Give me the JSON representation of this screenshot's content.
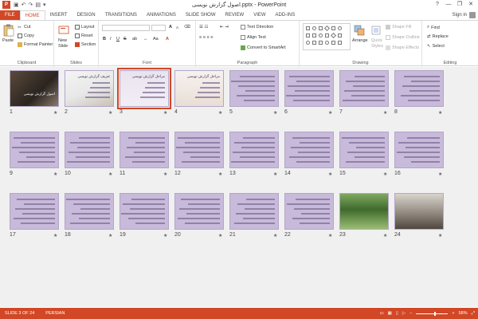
{
  "window": {
    "title": "اصول گزارش نویسی.pptx - PowerPoint",
    "controls": [
      "?",
      "—",
      "❐",
      "✕"
    ]
  },
  "tabs": [
    "FILE",
    "HOME",
    "INSERT",
    "DESIGN",
    "TRANSITIONS",
    "ANIMATIONS",
    "SLIDE SHOW",
    "REVIEW",
    "VIEW",
    "ADD-INS"
  ],
  "active_tab": "HOME",
  "signin": "Sign in",
  "ribbon": {
    "clipboard": {
      "label": "Clipboard",
      "paste": "Paste",
      "cut": "Cut",
      "copy": "Copy",
      "format_painter": "Format Painter"
    },
    "slides": {
      "label": "Slides",
      "new_slide_1": "New",
      "new_slide_2": "Slide",
      "layout": "Layout",
      "reset": "Reset",
      "section": "Section"
    },
    "font": {
      "label": "Font",
      "bold": "B",
      "italic": "I",
      "underline": "U",
      "strike": "S",
      "aa_grow": "A",
      "aa_shrink": "A"
    },
    "paragraph": {
      "label": "Paragraph",
      "text_direction": "Text Direction",
      "align_text": "Align Text",
      "convert_smartart": "Convert to SmartArt"
    },
    "drawing": {
      "label": "Drawing",
      "arrange": "Arrange",
      "quick_styles_1": "Quick",
      "quick_styles_2": "Styles",
      "shape_fill": "Shape Fill",
      "shape_outline": "Shape Outline",
      "shape_effects": "Shape Effects"
    },
    "editing": {
      "label": "Editing",
      "find": "Find",
      "replace": "Replace",
      "select": "Select"
    }
  },
  "slides": [
    {
      "n": "1",
      "kind": "img1",
      "title": "اصول گزارش نویسی"
    },
    {
      "n": "2",
      "kind": "img2",
      "title": "تعریف گزارش نویسی"
    },
    {
      "n": "3",
      "kind": "img3",
      "title": "مراحل گزارش نویسی",
      "selected": true
    },
    {
      "n": "4",
      "kind": "img4",
      "title": "مراحل گزارش نویسی"
    },
    {
      "n": "5",
      "kind": "text"
    },
    {
      "n": "6",
      "kind": "text"
    },
    {
      "n": "7",
      "kind": "text"
    },
    {
      "n": "8",
      "kind": "text"
    },
    {
      "n": "9",
      "kind": "text"
    },
    {
      "n": "10",
      "kind": "text"
    },
    {
      "n": "11",
      "kind": "text"
    },
    {
      "n": "12",
      "kind": "text"
    },
    {
      "n": "13",
      "kind": "text"
    },
    {
      "n": "14",
      "kind": "text"
    },
    {
      "n": "15",
      "kind": "text"
    },
    {
      "n": "16",
      "kind": "text"
    },
    {
      "n": "17",
      "kind": "text"
    },
    {
      "n": "18",
      "kind": "text"
    },
    {
      "n": "19",
      "kind": "text"
    },
    {
      "n": "20",
      "kind": "text"
    },
    {
      "n": "21",
      "kind": "text"
    },
    {
      "n": "22",
      "kind": "text"
    },
    {
      "n": "23",
      "kind": "green"
    },
    {
      "n": "24",
      "kind": "laptop"
    }
  ],
  "status": {
    "slide_of": "SLIDE 3 OF 24",
    "language": "PERSIAN",
    "zoom": "58%",
    "zoom_level": 0.58
  },
  "colors": {
    "accent": "#d24726",
    "slide_bg": "#c8bada"
  }
}
